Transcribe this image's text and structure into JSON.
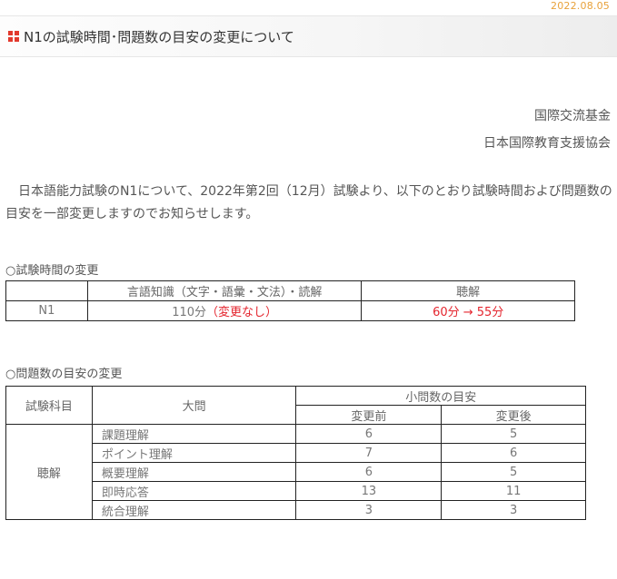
{
  "date": "2022.08.05",
  "title": "N1の試験時間･問題数の目安の変更について",
  "org1": "国際交流基金",
  "org2": "日本国際教育支援協会",
  "intro": "日本語能力試験のN1について、2022年第2回（12月）試験より、以下のとおり試験時間および問題数の目安を一部変更しますのでお知らせします。",
  "section1_title": "○試験時間の変更",
  "time_table": {
    "headers": [
      "",
      "言語知識（文字・語彙・文法）・読解",
      "聴解"
    ],
    "row": {
      "level": "N1",
      "knowledge_time": "110分",
      "knowledge_note": "（変更なし）",
      "listening_change": "60分 → 55分"
    }
  },
  "section2_title": "○問題数の目安の変更",
  "count_table": {
    "h_subject": "試験科目",
    "h_section": "大問",
    "h_guideline": "小問数の目安",
    "h_before": "変更前",
    "h_after": "変更後",
    "subject": "聴解",
    "rows": [
      {
        "name": "課題理解",
        "before": "6",
        "after": "5"
      },
      {
        "name": "ポイント理解",
        "before": "7",
        "after": "6"
      },
      {
        "name": "概要理解",
        "before": "6",
        "after": "5"
      },
      {
        "name": "即時応答",
        "before": "13",
        "after": "11"
      },
      {
        "name": "統合理解",
        "before": "3",
        "after": "3"
      }
    ]
  },
  "colors": {
    "accent": "#e2392d",
    "date": "#e8a13a",
    "change": "#e4252e"
  }
}
